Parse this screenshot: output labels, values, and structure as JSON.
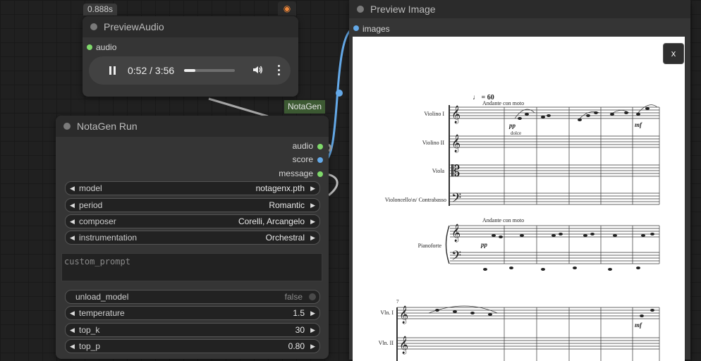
{
  "preview_audio": {
    "title": "PreviewAudio",
    "timing": "0.888s",
    "input_label": "audio",
    "current_time": "0:52",
    "time_separator": " / ",
    "duration": "3:56",
    "progress": 0.22
  },
  "group_badge": "NotaGen",
  "notagen_run": {
    "title": "NotaGen Run",
    "outputs": [
      "audio",
      "score",
      "message"
    ],
    "combo_widgets": [
      {
        "label": "model",
        "value": "notagenx.pth"
      },
      {
        "label": "period",
        "value": "Romantic"
      },
      {
        "label": "composer",
        "value": "Corelli, Arcangelo"
      },
      {
        "label": "instrumentation",
        "value": "Orchestral"
      }
    ],
    "custom_prompt_placeholder": "custom_prompt",
    "toggle": {
      "label": "unload_model",
      "value": "false"
    },
    "number_widgets": [
      {
        "label": "temperature",
        "value": "1.5"
      },
      {
        "label": "top_k",
        "value": "30"
      },
      {
        "label": "top_p",
        "value": "0.80"
      }
    ]
  },
  "preview_image": {
    "title": "Preview Image",
    "input_label": "images",
    "close_label": "x",
    "score": {
      "tempo": "♩ = 60",
      "expression": "Andante con moto",
      "dynamic_pp": "pp",
      "dolce": "dolce",
      "dynamic_mf": "mf",
      "instruments": [
        "Violino I",
        "Violino II",
        "Viola",
        "Violoncello\\n/ Contrabasso",
        "Pianoforte"
      ],
      "second_system_measure": "7",
      "second_system_instruments": [
        "Vln. I",
        "Vln. II"
      ]
    }
  },
  "colors": {
    "audio_slot": "#7fd96b",
    "score_slot": "#64a9e8",
    "message_slot": "#7fd96b",
    "image_link": "#64a9e8",
    "group_badge": "#3d5a33"
  },
  "icons": [
    "pause-icon",
    "volume-icon",
    "more-vert-icon",
    "fox-icon"
  ]
}
